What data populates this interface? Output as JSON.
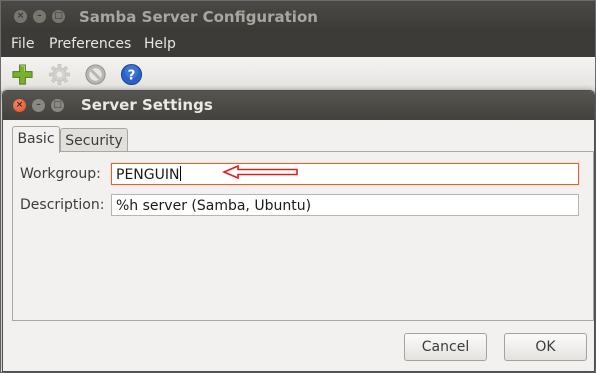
{
  "main_window": {
    "title": "Samba Server Configuration",
    "menu": [
      "File",
      "Preferences",
      "Help"
    ],
    "toolbar": [
      {
        "icon": "add-icon",
        "enabled": true
      },
      {
        "icon": "gear-icon",
        "enabled": false
      },
      {
        "icon": "stop-icon",
        "enabled": true
      },
      {
        "icon": "help-icon",
        "enabled": true
      }
    ]
  },
  "dialog": {
    "title": "Server Settings",
    "tabs": [
      {
        "label": "Basic",
        "active": true
      },
      {
        "label": "Security",
        "active": false
      }
    ],
    "fields": {
      "workgroup": {
        "label": "Workgroup:",
        "value": "PENGUIN"
      },
      "description": {
        "label": "Description:",
        "value": "%h server (Samba, Ubuntu)"
      }
    },
    "buttons": {
      "cancel": "Cancel",
      "ok": "OK"
    }
  },
  "colors": {
    "titlebar": "#3c3b37",
    "focus_border": "#e8622c",
    "close_button": "#df4b20",
    "annotation_arrow": "#e02020",
    "add_icon": "#7ab02e",
    "help_icon": "#2a62c5"
  }
}
